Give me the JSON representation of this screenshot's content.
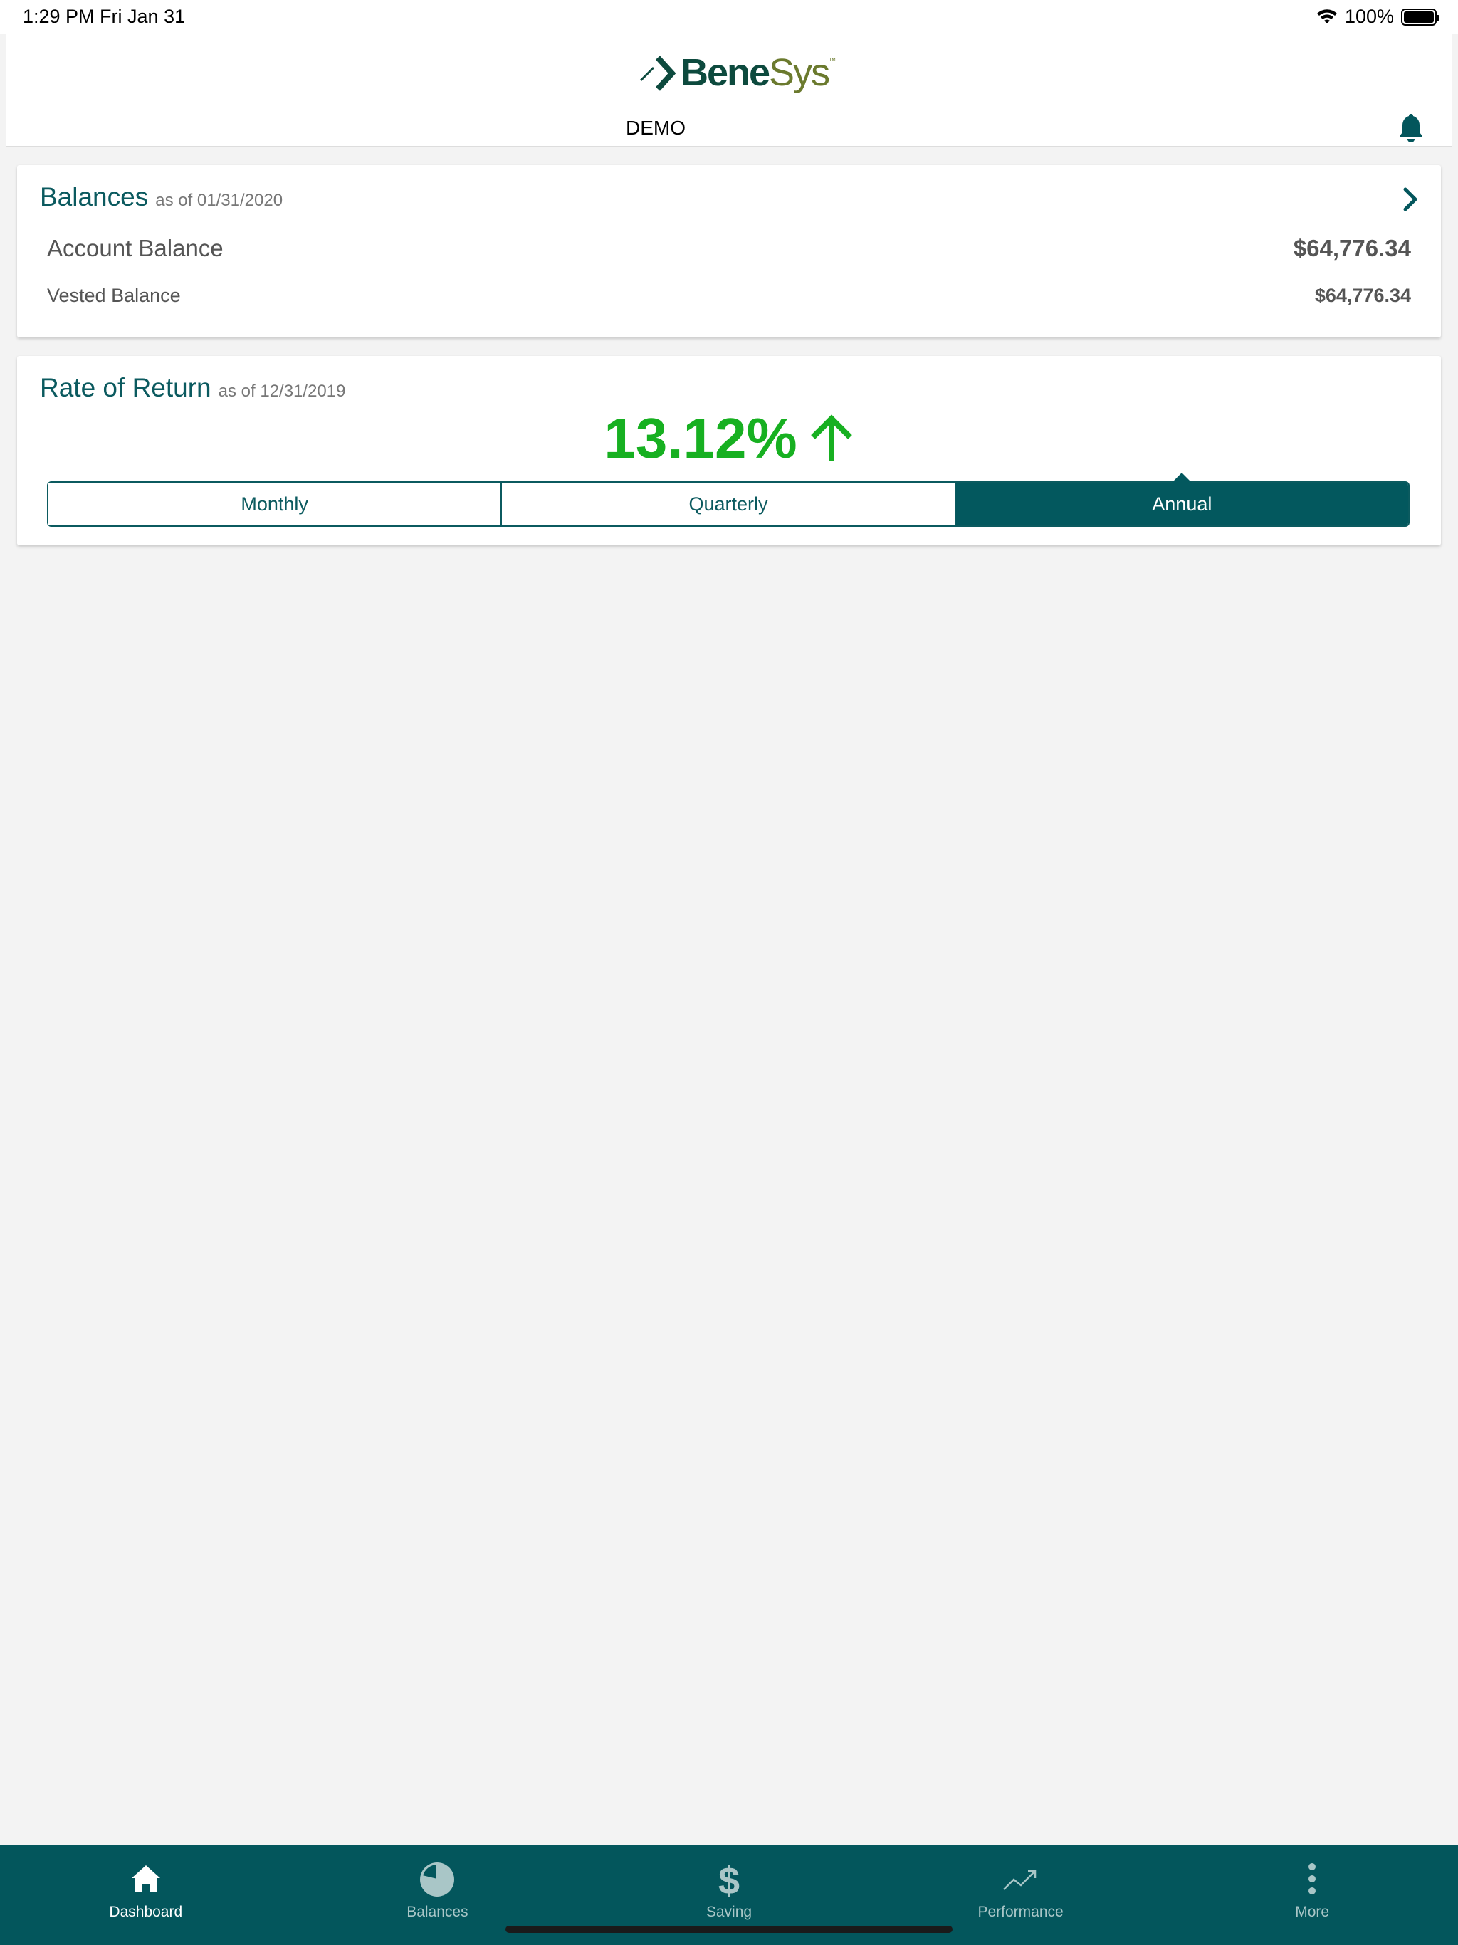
{
  "status_bar": {
    "time": "1:29 PM   Fri Jan 31",
    "battery": "100%"
  },
  "header": {
    "logo_bene": "Bene",
    "logo_sys": "Sys",
    "title": "DEMO",
    "bell_icon": "bell-icon"
  },
  "balances": {
    "title": "Balances",
    "as_of": "as of 01/31/2020",
    "account_label": "Account Balance",
    "account_value": "$64,776.34",
    "vested_label": "Vested Balance",
    "vested_value": "$64,776.34"
  },
  "rate_of_return": {
    "title": "Rate of Return",
    "as_of": "as of 12/31/2019",
    "value": "13.12%",
    "direction": "up",
    "tabs": [
      "Monthly",
      "Quarterly",
      "Annual"
    ],
    "active_tab": "Annual"
  },
  "bottom_nav": {
    "items": [
      {
        "label": "Dashboard",
        "icon": "home-icon",
        "active": true
      },
      {
        "label": "Balances",
        "icon": "pie-chart-icon",
        "active": false
      },
      {
        "label": "Saving",
        "icon": "dollar-icon",
        "active": false
      },
      {
        "label": "Performance",
        "icon": "trend-icon",
        "active": false
      },
      {
        "label": "More",
        "icon": "more-vertical-icon",
        "active": false
      }
    ]
  },
  "colors": {
    "brand_teal": "#03565c",
    "positive_green": "#17b021",
    "logo_green": "#0d4a3e",
    "logo_olive": "#6b7a2e"
  }
}
